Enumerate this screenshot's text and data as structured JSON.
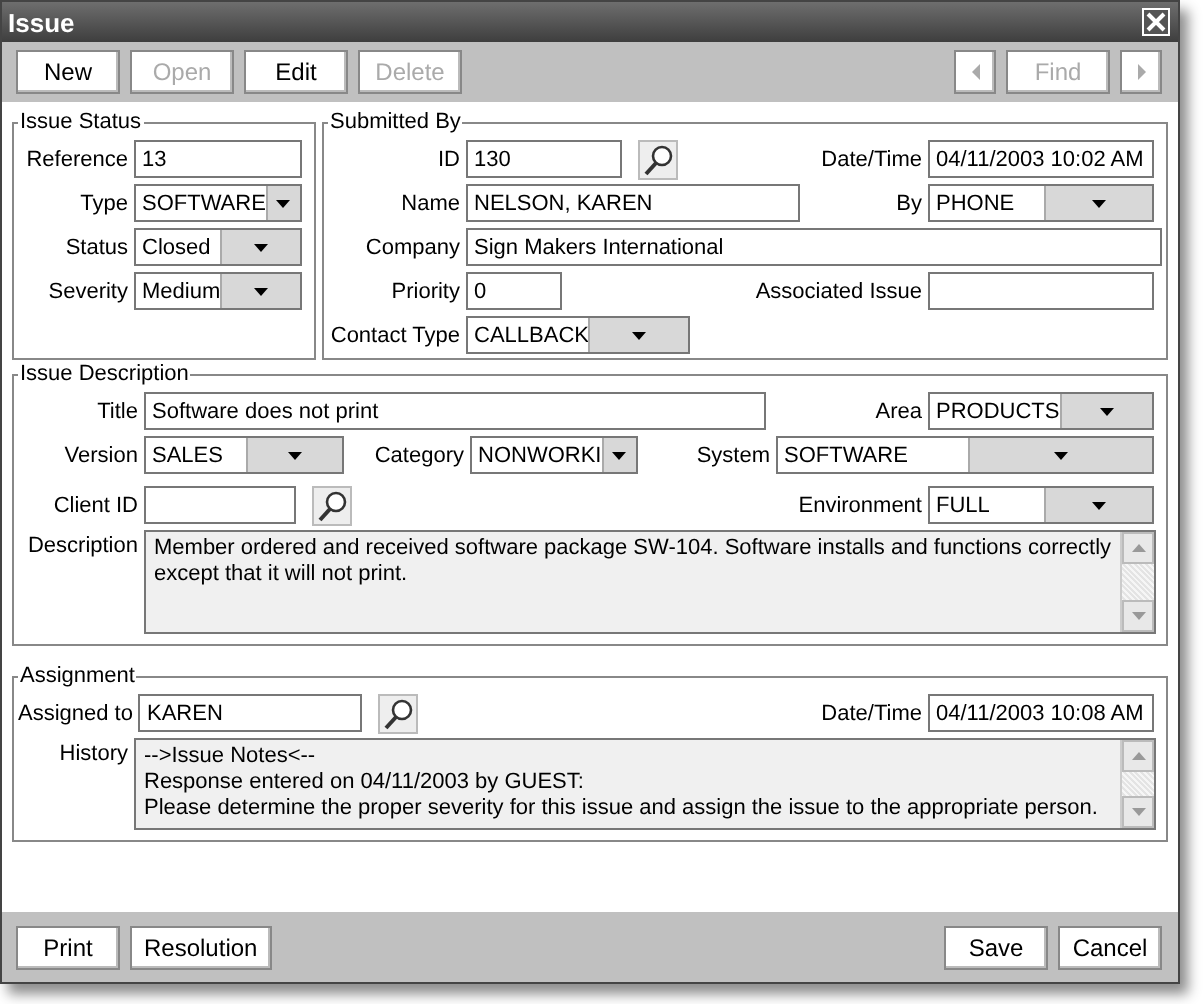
{
  "window": {
    "title": "Issue"
  },
  "toolbar": {
    "left": [
      {
        "label": "New",
        "disabled": false
      },
      {
        "label": "Open",
        "disabled": true
      },
      {
        "label": "Edit",
        "disabled": false
      },
      {
        "label": "Delete",
        "disabled": true
      }
    ],
    "right": [
      {
        "kind": "prev",
        "disabled": true
      },
      {
        "kind": "find",
        "label": "Find",
        "disabled": true
      },
      {
        "kind": "next",
        "disabled": true
      }
    ]
  },
  "issue_status": {
    "title": "Issue Status",
    "fields": [
      {
        "label": "Reference",
        "value": "13",
        "kind": "text"
      },
      {
        "label": "Type",
        "value": "SOFTWARE",
        "kind": "dropdown"
      },
      {
        "label": "Status",
        "value": "Closed",
        "kind": "dropdown"
      },
      {
        "label": "Severity",
        "value": "Medium",
        "kind": "dropdown"
      }
    ]
  },
  "submitted_by": {
    "title": "Submitted By",
    "fields": [
      {
        "label": "ID",
        "value": "130",
        "kind": "lookup"
      },
      {
        "label": "Date/Time",
        "value": "04/11/2003 10:02 AM",
        "kind": "text"
      },
      {
        "label": "Name",
        "value": "NELSON, KAREN",
        "kind": "text"
      },
      {
        "label": "By",
        "value": "PHONE",
        "kind": "dropdown"
      },
      {
        "label": "Company",
        "value": "Sign Makers International",
        "kind": "text"
      },
      {
        "label": "Priority",
        "value": "0",
        "kind": "text"
      },
      {
        "label": "Associated Issue",
        "kind": "text"
      },
      {
        "label": "Contact Type",
        "value": "CALLBACK",
        "kind": "dropdown"
      }
    ]
  },
  "issue_description": {
    "title": "Issue Description",
    "fields": [
      {
        "label": "Title",
        "value": "Software does not print",
        "kind": "text"
      },
      {
        "label": "Area",
        "value": "PRODUCTS",
        "kind": "dropdown"
      },
      {
        "label": "Version",
        "value": "SALES",
        "kind": "dropdown"
      },
      {
        "label": "Category",
        "value": "NONWORKI",
        "kind": "dropdown"
      },
      {
        "label": "System",
        "value": "SOFTWARE",
        "kind": "dropdown"
      },
      {
        "label": "Client ID",
        "kind": "lookup"
      },
      {
        "label": "Environment",
        "value": "FULL",
        "kind": "dropdown"
      }
    ],
    "description": {
      "label": "Description",
      "lines": [
        "Member ordered and received software package SW-104. Software installs and functions correctly except that it will not print."
      ]
    }
  },
  "assignment": {
    "title": "Assignment",
    "fields": [
      {
        "label": "Assigned to",
        "value": "KAREN",
        "kind": "lookup"
      },
      {
        "label": "Date/Time",
        "value": "04/11/2003 10:08 AM",
        "kind": "text"
      }
    ],
    "history": {
      "label": "History",
      "lines": [
        "-->Issue Notes<--",
        "Response entered on 04/11/2003 by GUEST:",
        "Please determine the proper severity for this issue and assign the issue to the appropriate person."
      ]
    }
  },
  "footer": {
    "left": [
      {
        "label": "Print",
        "disabled": false
      },
      {
        "label": "Resolution",
        "disabled": false
      }
    ],
    "right": [
      {
        "label": "Save",
        "disabled": false
      },
      {
        "label": "Cancel",
        "disabled": false
      }
    ]
  }
}
